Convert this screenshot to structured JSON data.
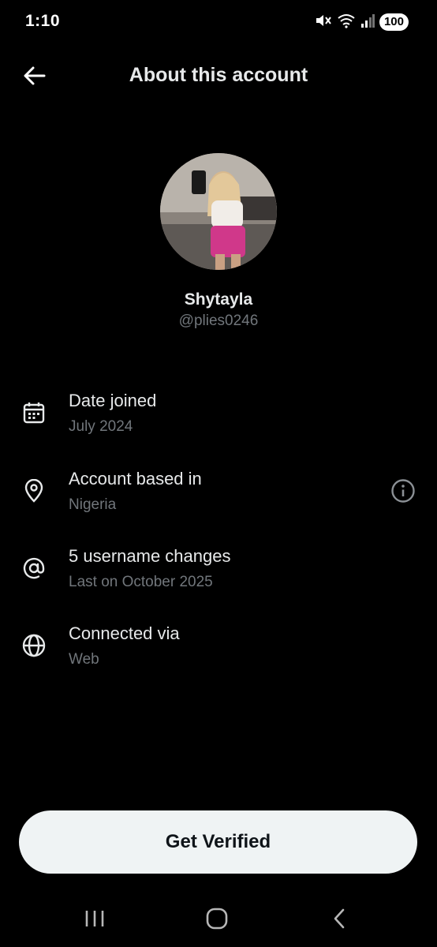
{
  "status_bar": {
    "time": "1:10",
    "battery": "100",
    "icons": [
      "mute-icon",
      "wifi-icon",
      "signal-icon"
    ]
  },
  "header": {
    "title": "About this account",
    "back_icon": "back-arrow-icon"
  },
  "profile": {
    "display_name": "Shytayla",
    "handle": "@plies0246"
  },
  "details": [
    {
      "icon": "calendar-icon",
      "title": "Date joined",
      "value": "July 2024"
    },
    {
      "icon": "location-pin-icon",
      "title": "Account based in",
      "value": "Nigeria",
      "extra_icon": "info-icon"
    },
    {
      "icon": "at-sign-icon",
      "title": "5 username changes",
      "value": "Last on October 2025"
    },
    {
      "icon": "globe-icon",
      "title": "Connected via",
      "value": "Web"
    }
  ],
  "cta": {
    "label": "Get Verified"
  },
  "system_nav": {
    "items": [
      "recent-apps-icon",
      "home-icon",
      "back-icon"
    ]
  },
  "colors": {
    "background": "#000000",
    "primary_text": "#e7e9ea",
    "secondary_text": "#71767b",
    "button_bg": "#eff3f4",
    "button_text": "#0f1419"
  }
}
